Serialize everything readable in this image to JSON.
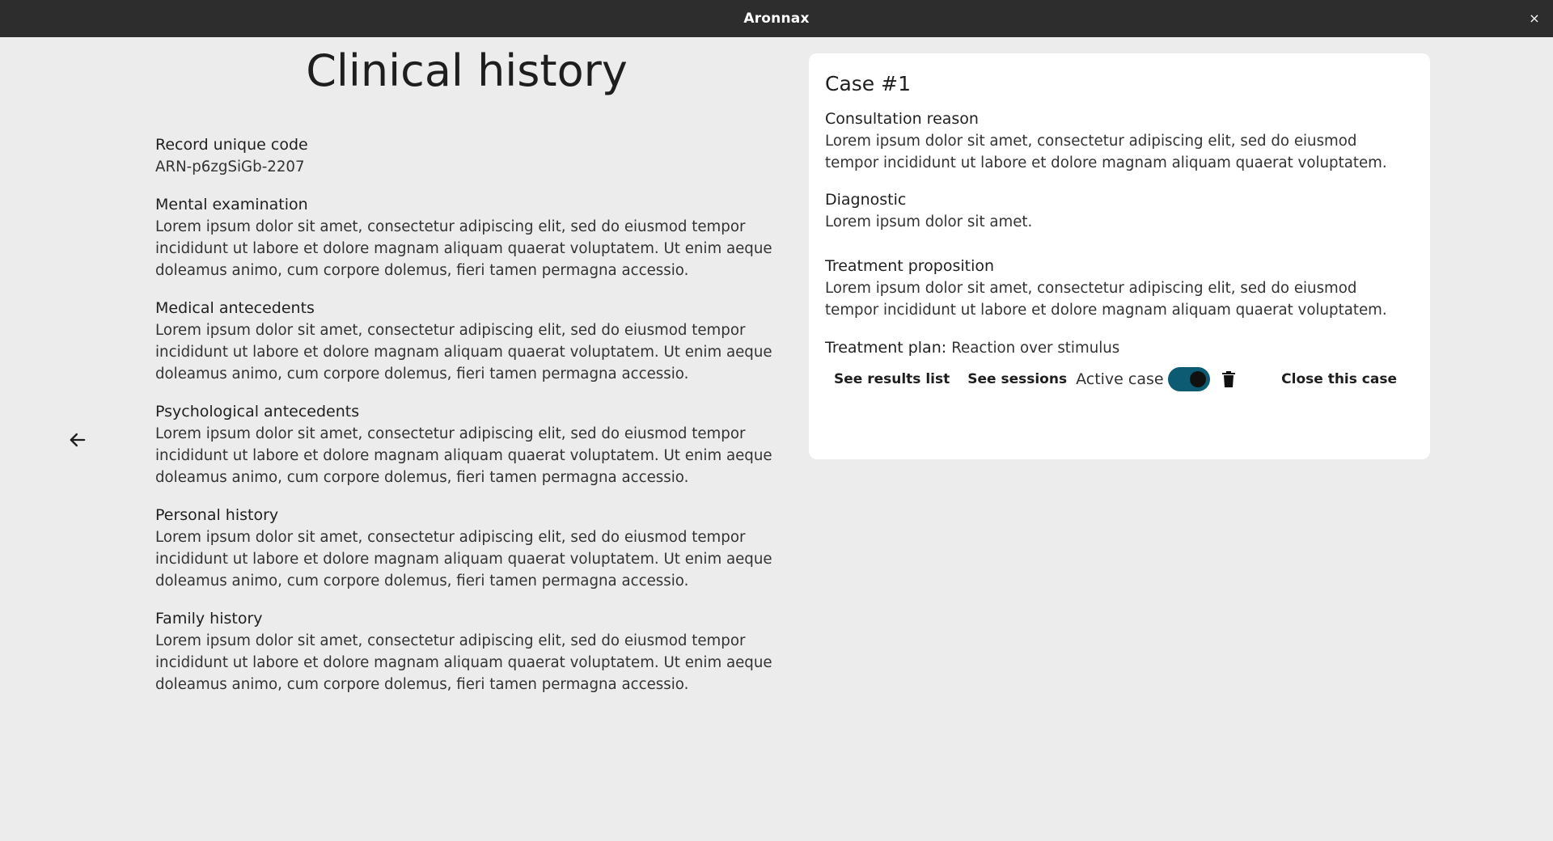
{
  "window": {
    "title": "Aronnax",
    "close_glyph": "×"
  },
  "page": {
    "title": "Clinical history"
  },
  "record": {
    "label": "Record unique code",
    "value": "ARN-p6zgSiGb-2207"
  },
  "sections": [
    {
      "label": "Mental examination",
      "text": "Lorem ipsum dolor sit amet, consectetur adipiscing elit, sed do eiusmod tempor incididunt ut labore et dolore magnam aliquam quaerat voluptatem. Ut enim aeque doleamus animo, cum corpore dolemus, fieri tamen permagna accessio."
    },
    {
      "label": "Medical antecedents",
      "text": "Lorem ipsum dolor sit amet, consectetur adipiscing elit, sed do eiusmod tempor incididunt ut labore et dolore magnam aliquam quaerat voluptatem. Ut enim aeque doleamus animo, cum corpore dolemus, fieri tamen permagna accessio."
    },
    {
      "label": "Psychological antecedents",
      "text": "Lorem ipsum dolor sit amet, consectetur adipiscing elit, sed do eiusmod tempor incididunt ut labore et dolore magnam aliquam quaerat voluptatem. Ut enim aeque doleamus animo, cum corpore dolemus, fieri tamen permagna accessio."
    },
    {
      "label": "Personal history",
      "text": "Lorem ipsum dolor sit amet, consectetur adipiscing elit, sed do eiusmod tempor incididunt ut labore et dolore magnam aliquam quaerat voluptatem. Ut enim aeque doleamus animo, cum corpore dolemus, fieri tamen permagna accessio."
    },
    {
      "label": "Family history",
      "text": "Lorem ipsum dolor sit amet, consectetur adipiscing elit, sed do eiusmod tempor incididunt ut labore et dolore magnam aliquam quaerat voluptatem. Ut enim aeque doleamus animo, cum corpore dolemus, fieri tamen permagna accessio."
    }
  ],
  "case": {
    "title": "Case #1",
    "consultation": {
      "label": "Consultation reason",
      "text": "Lorem ipsum dolor sit amet, consectetur adipiscing elit, sed do eiusmod tempor incididunt ut labore et dolore magnam aliquam quaerat voluptatem."
    },
    "diagnostic": {
      "label": "Diagnostic",
      "text": "Lorem ipsum dolor sit amet."
    },
    "treatment": {
      "label": "Treatment proposition",
      "text": "Lorem ipsum dolor sit amet, consectetur adipiscing elit, sed do eiusmod tempor incididunt ut labore et dolore magnam aliquam quaerat voluptatem."
    },
    "plan": {
      "label": "Treatment plan:",
      "value": "Reaction over stimulus"
    },
    "actions": {
      "results_label": "See results list",
      "sessions_label": "See sessions",
      "active_label": "Active case",
      "active": true,
      "close_label": "Close this case"
    }
  },
  "icons": {
    "back": "arrow-left-icon",
    "delete": "trash-icon",
    "close": "close-icon"
  },
  "colors": {
    "background": "#ececec",
    "titlebar": "#2d2d2d",
    "card": "#ffffff",
    "toggle_track": "#0d5a73",
    "toggle_knob": "#111111"
  }
}
